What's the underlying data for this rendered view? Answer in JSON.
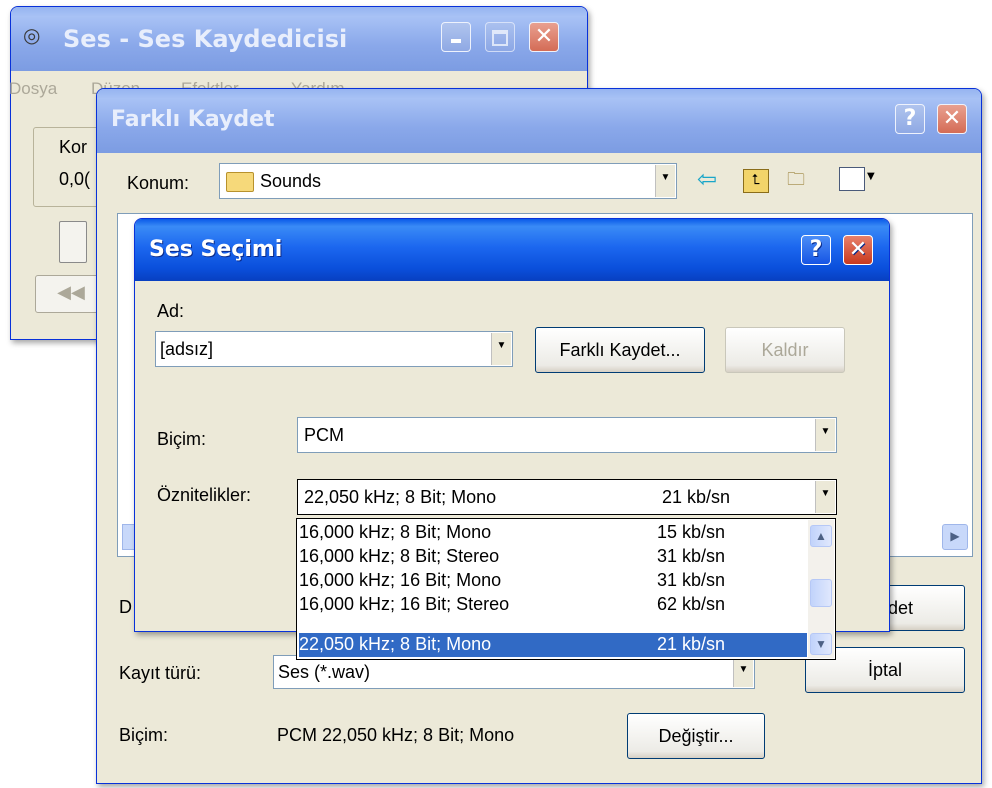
{
  "recorder": {
    "title": "Ses - Ses Kaydedicisi",
    "menu": [
      "Dosya",
      "Düzen",
      "Efektler",
      "Yardım"
    ],
    "position_label": "Kor",
    "position_value": "0,0("
  },
  "save_dialog": {
    "title": "Farklı Kaydet",
    "location_label": "Konum:",
    "location_value": "Sounds",
    "file_name_label_partial": "D",
    "save_button_partial": "det",
    "type_label": "Kayıt türü:",
    "type_value": "Ses (*.wav)",
    "cancel_button": "İptal",
    "format_label": "Biçim:",
    "format_value": "PCM 22,050 kHz; 8 Bit; Mono",
    "change_button": "Değiştir..."
  },
  "sound_dialog": {
    "title": "Ses Seçimi",
    "name_label": "Ad:",
    "name_value": "[adsız]",
    "save_as_button": "Farklı Kaydet...",
    "remove_button": "Kaldır",
    "format_label": "Biçim:",
    "format_value": "PCM",
    "attributes_label": "Öznitelikler:",
    "attributes_value": "22,050 kHz; 8 Bit; Mono",
    "attributes_rate": "21 kb/sn",
    "options": [
      {
        "name": "16,000 kHz; 8 Bit; Mono",
        "rate": "15 kb/sn"
      },
      {
        "name": "16,000 kHz; 8 Bit; Stereo",
        "rate": "31 kb/sn"
      },
      {
        "name": "16,000 kHz; 16 Bit; Mono",
        "rate": "31 kb/sn"
      },
      {
        "name": "16,000 kHz; 16 Bit; Stereo",
        "rate": "62 kb/sn"
      },
      {
        "name": "22,050 kHz; 8 Bit; Mono",
        "rate": "21 kb/sn"
      }
    ],
    "selected_option_index": 4
  },
  "colors": {
    "title_active": "#0a4fdb",
    "selection": "#316ac5",
    "window_face": "#ece9d8"
  }
}
